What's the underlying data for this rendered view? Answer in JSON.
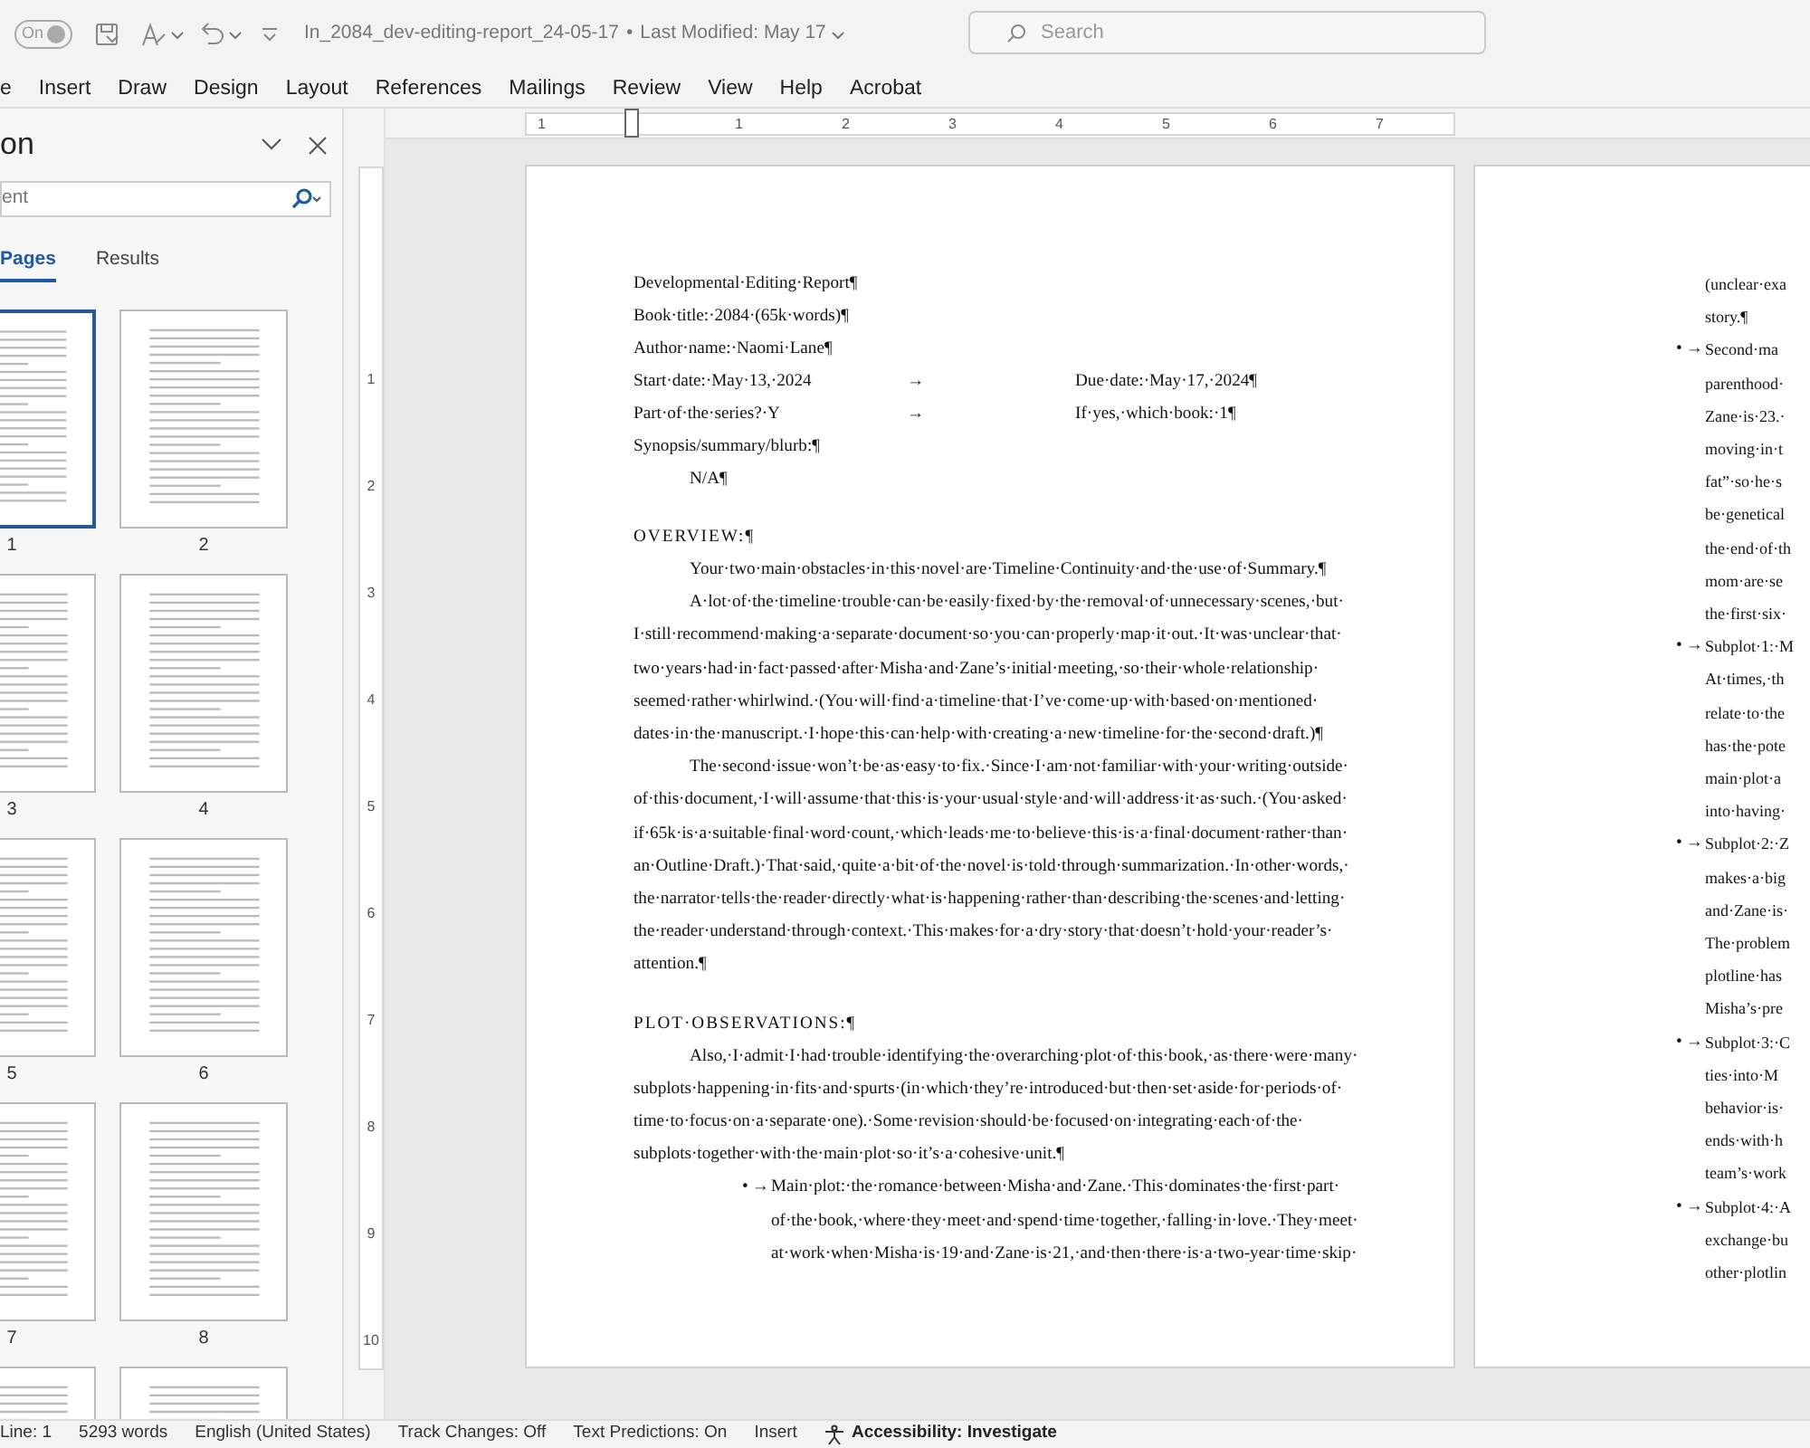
{
  "title_bar": {
    "autosave": {
      "label": "On",
      "on": true
    },
    "document_title": "In_2084_dev-editing-report_24-05-17",
    "separator": "•",
    "last_modified": "Last Modified: May 17",
    "search": {
      "placeholder": "Search"
    }
  },
  "ribbon_tabs": [
    "e",
    "Insert",
    "Draw",
    "Design",
    "Layout",
    "References",
    "Mailings",
    "Review",
    "View",
    "Help",
    "Acrobat"
  ],
  "navigation_pane": {
    "title": "on",
    "search": {
      "placeholder": "ent"
    },
    "tabs": [
      {
        "label": "Pages",
        "selected": true
      },
      {
        "label": "Results",
        "selected": false
      }
    ],
    "thumbnails": [
      {
        "label": "1",
        "selected": true
      },
      {
        "label": "2",
        "selected": false
      },
      {
        "label": "3",
        "selected": false
      },
      {
        "label": "4",
        "selected": false
      },
      {
        "label": "5",
        "selected": false
      },
      {
        "label": "6",
        "selected": false
      },
      {
        "label": "7",
        "selected": false
      },
      {
        "label": "8",
        "selected": false
      },
      {
        "selected": false
      },
      {
        "selected": false
      }
    ]
  },
  "rulers": {
    "horizontal": [
      "1",
      "1",
      "2",
      "3",
      "4",
      "5",
      "6",
      "7"
    ],
    "vertical": [
      "1",
      "2",
      "3",
      "4",
      "5",
      "6",
      "7",
      "8",
      "9",
      "10"
    ]
  },
  "pages": [
    {
      "blocks": [
        {
          "kind": "line",
          "text": "Developmental·Editing·Report¶"
        },
        {
          "kind": "line",
          "text": "Book·title:·2084·(65k·words)¶"
        },
        {
          "kind": "line",
          "text": "Author·name:·Naomi·Lane¶"
        },
        {
          "kind": "tabbed",
          "left": "Start·date:·May·13,·2024",
          "tab": "→",
          "right": "Due·date:·May·17,·2024¶"
        },
        {
          "kind": "tabbed",
          "left": "Part·of·the·series?·Y",
          "tab": "→",
          "right": "If·yes,·which·book:·1¶"
        },
        {
          "kind": "line",
          "text": "Synopsis/summary/blurb:¶"
        },
        {
          "kind": "indented",
          "text": "N/A¶"
        },
        {
          "kind": "heading",
          "text": "OVERVIEW:¶"
        },
        {
          "kind": "paragraph",
          "lines": [
            "Your·two·main·obstacles·in·this·novel·are·Timeline·Continuity·and·the·use·of·Summary.¶"
          ]
        },
        {
          "kind": "paragraph",
          "lines": [
            "A·lot·of·the·timeline·trouble·can·be·easily·fixed·by·the·removal·of·unnecessary·scenes,·but·",
            "I·still·recommend·making·a·separate·document·so·you·can·properly·map·it·out.·It·was·unclear·that·",
            "two·years·had·in·fact·passed·after·Misha·and·Zane’s·initial·meeting,·so·their·whole·relationship·",
            "seemed·rather·whirlwind.·(You·will·find·a·timeline·that·I’ve·come·up·with·based·on·mentioned·",
            "dates·in·the·manuscript.·I·hope·this·can·help·with·creating·a·new·timeline·for·the·second·draft.)¶"
          ]
        },
        {
          "kind": "paragraph",
          "lines": [
            "The·second·issue·won’t·be·as·easy·to·fix.·Since·I·am·not·familiar·with·your·writing·outside·",
            "of·this·document,·I·will·assume·that·this·is·your·usual·style·and·will·address·it·as·such.·(You·asked·",
            "if·65k·is·a·suitable·final·word·count,·which·leads·me·to·believe·this·is·a·final·document·rather·than·",
            "an·Outline·Draft.)·That·said,·quite·a·bit·of·the·novel·is·told·through·summarization.·In·other·words,·",
            "the·narrator·tells·the·reader·directly·what·is·happening·rather·than·describing·the·scenes·and·letting·",
            "the·reader·understand·through·context.·This·makes·for·a·dry·story·that·doesn’t·hold·your·reader’s·",
            "attention.¶"
          ]
        },
        {
          "kind": "heading",
          "text": "PLOT·OBSERVATIONS:¶"
        },
        {
          "kind": "paragraph",
          "lines": [
            "Also,·I·admit·I·had·trouble·identifying·the·overarching·plot·of·this·book,·as·there·were·many·",
            "subplots·happening·in·fits·and·spurts·(in·which·they’re·introduced·but·then·set·aside·for·periods·of·",
            "time·to·focus·on·a·separate·one).·Some·revision·should·be·focused·on·integrating·each·of·the·",
            "subplots·together·with·the·main·plot·so·it’s·a·cohesive·unit.¶"
          ]
        },
        {
          "kind": "bullet",
          "bullet": "•",
          "tab": "→",
          "lines": [
            "Main·plot:·the·romance·between·Misha·and·Zane.·This·dominates·the·first·part·",
            "of·the·book,·where·they·meet·and·spend·time·together,·falling·in·love.·They·meet·",
            "at·work·when·Misha·is·19·and·Zane·is·21,·and·then·there·is·a·two-year·time·skip·"
          ]
        }
      ]
    },
    {
      "blocks": [
        {
          "kind": "continuation",
          "lines": [
            "(unclear·exa",
            "story.¶"
          ]
        },
        {
          "kind": "bullet",
          "bullet": "•",
          "tab": "→",
          "lines": [
            "Second·ma",
            "parenthood·",
            "Zane·is·23.·",
            "moving·in·t",
            "fat”·so·he·s",
            "be·genetical",
            "the·end·of·th",
            "mom·are·se",
            "the·first·six·"
          ]
        },
        {
          "kind": "bullet",
          "bullet": "•",
          "tab": "→",
          "lines": [
            "Subplot·1:·M",
            "At·times,·th",
            "relate·to·the",
            "has·the·pote",
            "main·plot·a",
            "into·having·"
          ]
        },
        {
          "kind": "bullet",
          "bullet": "•",
          "tab": "→",
          "lines": [
            "Subplot·2:·Z",
            "makes·a·big",
            "and·Zane·is·",
            "The·problem",
            "plotline·has",
            "Misha’s·pre"
          ]
        },
        {
          "kind": "bullet",
          "bullet": "•",
          "tab": "→",
          "lines": [
            "Subplot·3:·C",
            "ties·into·M",
            "behavior·is·",
            "ends·with·h",
            "team’s·work"
          ]
        },
        {
          "kind": "bullet",
          "bullet": "•",
          "tab": "→",
          "lines": [
            "Subplot·4:·A",
            "exchange·bu",
            "other·plotlin"
          ]
        }
      ]
    }
  ],
  "status_bar": {
    "items": [
      "Line: 1",
      "5293 words",
      "English (United States)",
      "Track Changes: Off",
      "Text Predictions: On",
      "Insert"
    ],
    "accessibility": "Accessibility: Investigate"
  }
}
